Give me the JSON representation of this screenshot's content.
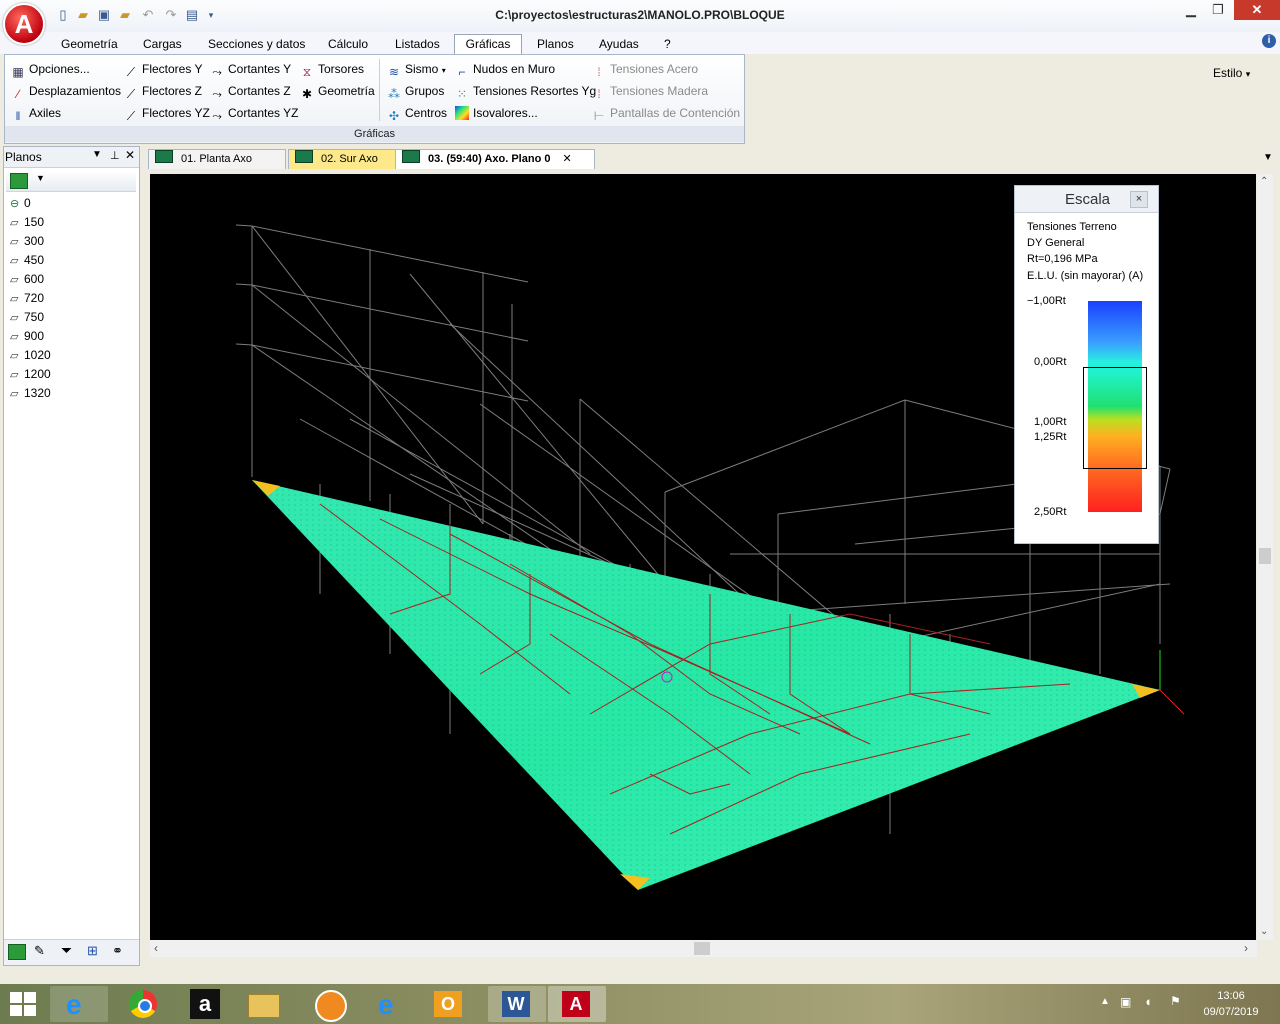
{
  "window": {
    "title": "C:\\proyectos\\estructuras2\\MANOLO.PRO\\BLOQUE",
    "logo_letter": "A"
  },
  "menu": {
    "tabs": [
      "Geometría",
      "Cargas",
      "Secciones y datos",
      "Cálculo",
      "Listados",
      "Gráficas",
      "Planos",
      "Ayudas",
      "?"
    ],
    "active_tab": "Gráficas",
    "style_label": "Estilo"
  },
  "ribbon": {
    "group_label": "Gráficas",
    "col1": [
      "Opciones...",
      "Desplazamientos",
      "Axiles"
    ],
    "col2": [
      "Flectores Y",
      "Flectores Z",
      "Flectores YZ"
    ],
    "col3": [
      "Cortantes Y",
      "Cortantes Z",
      "Cortantes YZ"
    ],
    "col4": [
      "Torsores",
      "Geometría"
    ],
    "col5": [
      "Sismo",
      "Grupos",
      "Centros"
    ],
    "col6": [
      "Nudos en Muro",
      "Tensiones Resortes Yg",
      "Isovalores..."
    ],
    "col7": [
      "Tensiones Acero",
      "Tensiones Madera",
      "Pantallas de Contención"
    ]
  },
  "planos": {
    "title": "Planos",
    "items": [
      "0",
      "150",
      "300",
      "450",
      "600",
      "720",
      "750",
      "900",
      "1020",
      "1200",
      "1320"
    ]
  },
  "doc_tabs": [
    "01. Planta   Axo",
    "02. Sur   Axo",
    "03.  (59:40)  Axo. Plano 0"
  ],
  "escala": {
    "title": "Escala",
    "close": "×",
    "line1": "Tensiones Terreno",
    "line2": "DY General",
    "line3": "Rt=0,196   MPa",
    "line4": "E.L.U. (sin mayorar) (A)",
    "ticks": [
      "−1,00Rt",
      "0,00Rt",
      "1,00Rt",
      "1,25Rt",
      "2,50Rt"
    ]
  },
  "taskbar": {
    "time": "13:06",
    "date": "09/07/2019"
  }
}
